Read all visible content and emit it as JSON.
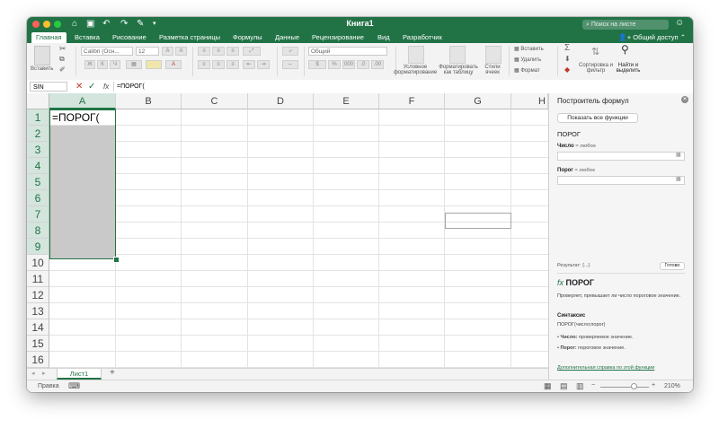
{
  "window": {
    "title": "Книга1",
    "search_placeholder": "Поиск на листе"
  },
  "tabs": [
    "Главная",
    "Вставка",
    "Рисование",
    "Разметка страницы",
    "Формулы",
    "Данные",
    "Рецензирование",
    "Вид",
    "Разработчик"
  ],
  "share_label": "Общий доступ",
  "ribbon": {
    "paste": "Вставить",
    "font_name": "Calibri (Осн...",
    "font_size": "12",
    "number_format": "Общий",
    "cond_format": "Условное форматирование",
    "format_table": "Форматировать как таблицу",
    "cell_styles": "Стили ячеек",
    "insert": "Вставить",
    "delete": "Удалить",
    "format": "Формат",
    "sort_filter": "Сортировка и фильтр",
    "find_select": "Найти и выделить",
    "bold": "Ж",
    "italic": "К",
    "underline": "Ч"
  },
  "formula_bar": {
    "name_box": "SIN",
    "fx": "fx",
    "content": "=ПОРОГ("
  },
  "columns": [
    "A",
    "B",
    "C",
    "D",
    "E",
    "F",
    "G",
    "H"
  ],
  "rows": [
    "1",
    "2",
    "3",
    "4",
    "5",
    "6",
    "7",
    "8",
    "9",
    "10",
    "11",
    "12",
    "13",
    "14",
    "15",
    "16"
  ],
  "cell_a1": "=ПОРОГ(",
  "sheet": {
    "name": "Лист1",
    "add": "+"
  },
  "status": {
    "mode": "Правка",
    "zoom": "210%"
  },
  "pane": {
    "title": "Построитель формул",
    "show_all": "Показать все функции",
    "func_name": "ПОРОГ",
    "arg1_label": "Число",
    "arg1_hint": "любое",
    "arg2_label": "Порог",
    "arg2_hint": "любое",
    "result_label": "Результат:",
    "result_value": "{...}",
    "done": "Готово",
    "help_fx": "fx",
    "help_title": "ПОРОГ",
    "help_desc": "Проверяет, превышает ли число пороговое значение.",
    "syntax_label": "Синтаксис",
    "syntax": "ПОРОГ(число;порог)",
    "bullet1_name": "Число:",
    "bullet1_text": "проверяемое значение.",
    "bullet2_name": "Порог:",
    "bullet2_text": "пороговое значение.",
    "more_help": "Дополнительная справка по этой функции"
  },
  "colors": {
    "accent": "#217346",
    "selection": "#c9c9c9"
  }
}
